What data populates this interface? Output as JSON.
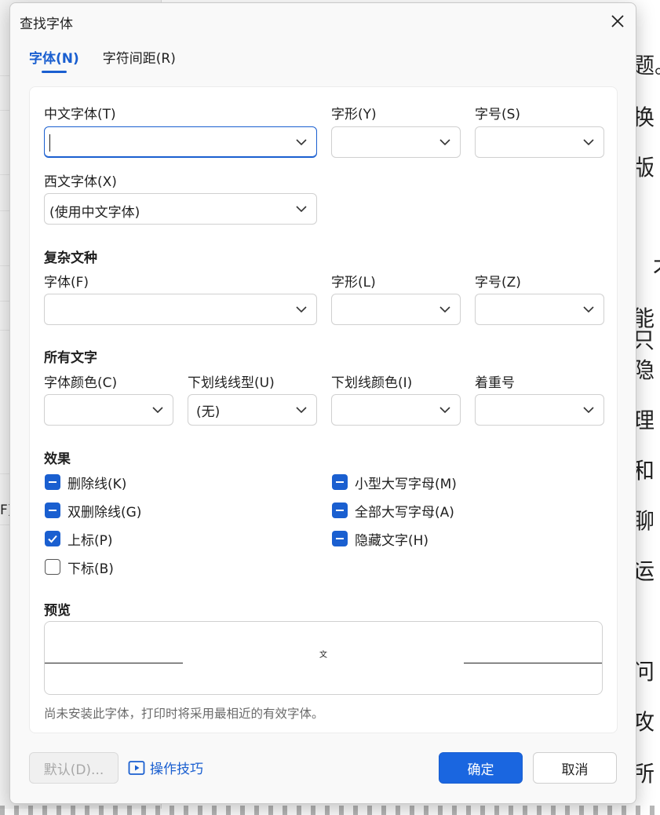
{
  "background": {
    "left_label": "F)",
    "doc_chars": [
      "题。",
      "换",
      "版",
      "才",
      "能只",
      "隐",
      "理",
      "和",
      "聊",
      "运",
      "问",
      "攻",
      "所"
    ]
  },
  "dialog": {
    "title": "查找字体",
    "tabs": [
      {
        "label": "字体(N)",
        "active": true
      },
      {
        "label": "字符间距(R)",
        "active": false
      }
    ]
  },
  "chinese": {
    "font_label": "中文字体(T)",
    "font_value": "",
    "style_label": "字形(Y)",
    "style_value": "",
    "size_label": "字号(S)",
    "size_value": ""
  },
  "western": {
    "font_label": "西文字体(X)",
    "font_value": "(使用中文字体)"
  },
  "complex": {
    "section": "复杂文种",
    "font_label": "字体(F)",
    "font_value": "",
    "style_label": "字形(L)",
    "style_value": "",
    "size_label": "字号(Z)",
    "size_value": ""
  },
  "all_text": {
    "section": "所有文字",
    "color_label": "字体颜色(C)",
    "color_value": "",
    "underline_label": "下划线线型(U)",
    "underline_value": "(无)",
    "underline_color_label": "下划线颜色(I)",
    "underline_color_value": "",
    "emphasis_label": "着重号",
    "emphasis_value": ""
  },
  "effects": {
    "section": "效果",
    "items": [
      {
        "label": "删除线(K)",
        "state": "indeterminate"
      },
      {
        "label": "双删除线(G)",
        "state": "indeterminate"
      },
      {
        "label": "上标(P)",
        "state": "checked"
      },
      {
        "label": "下标(B)",
        "state": "unchecked"
      },
      {
        "label": "小型大写字母(M)",
        "state": "indeterminate"
      },
      {
        "label": "全部大写字母(A)",
        "state": "indeterminate"
      },
      {
        "label": "隐藏文字(H)",
        "state": "indeterminate"
      }
    ]
  },
  "preview": {
    "section": "预览",
    "sample": "文",
    "note": "尚未安装此字体，打印时将采用最相近的有效字体。"
  },
  "footer": {
    "default_label": "默认(D)...",
    "tips_label": "操作技巧",
    "ok_label": "确定",
    "cancel_label": "取消"
  },
  "colors": {
    "accent": "#1a5fd0",
    "primary_button": "#1a66e0"
  }
}
